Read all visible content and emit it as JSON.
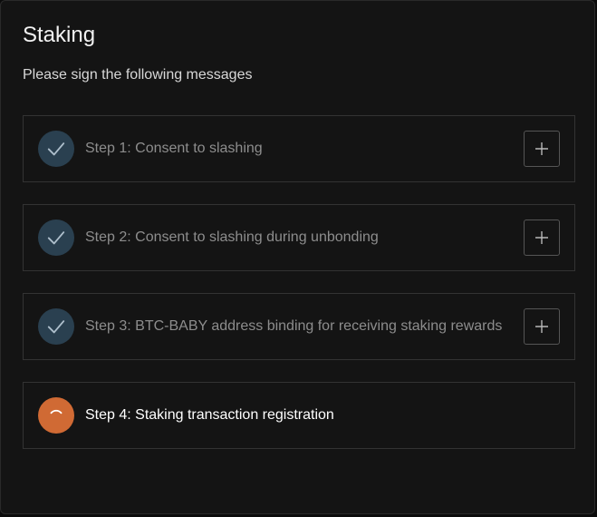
{
  "dialog": {
    "title": "Staking",
    "subtitle": "Please sign the following messages"
  },
  "steps": [
    {
      "label": "Step 1: Consent to slashing",
      "status": "complete",
      "icon": "check-icon",
      "expand_icon": "plus-icon"
    },
    {
      "label": "Step 2: Consent to slashing during unbonding",
      "status": "complete",
      "icon": "check-icon",
      "expand_icon": "plus-icon"
    },
    {
      "label": "Step 3: BTC-BABY address binding for receiving staking rewards",
      "status": "complete",
      "icon": "check-icon",
      "expand_icon": "plus-icon"
    },
    {
      "label": "Step 4: Staking transaction registration",
      "status": "in-progress",
      "icon": "spinner-icon"
    }
  ],
  "colors": {
    "background": "#141414",
    "complete_circle": "#2a4050",
    "active_circle": "#d06a34",
    "complete_text": "#8d8d8d",
    "active_text": "#ffffff"
  }
}
